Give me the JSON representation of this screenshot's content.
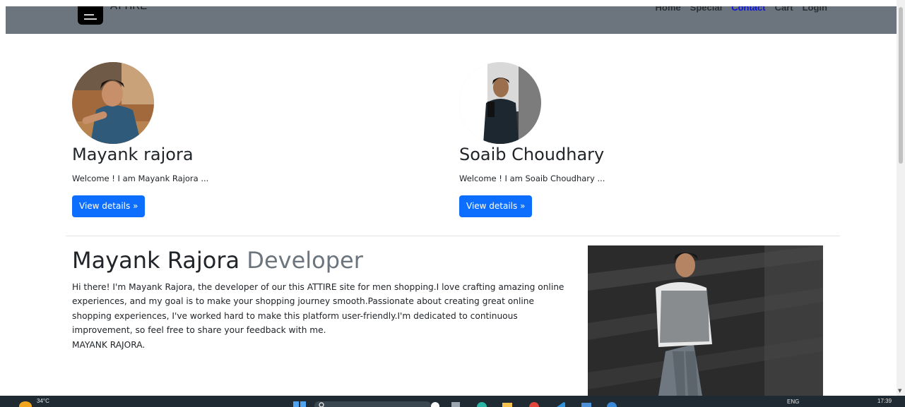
{
  "navbar": {
    "brand": "ATTIRE",
    "links": [
      {
        "label": "Home"
      },
      {
        "label": "Special"
      },
      {
        "label": "Contact"
      },
      {
        "label": "Cart"
      },
      {
        "label": "Login"
      }
    ],
    "active_link": "Contact"
  },
  "team": [
    {
      "name": "Mayank rajora",
      "description": "Welcome ! I am Mayank Rajora ...",
      "button": "View details »"
    },
    {
      "name": "Soaib Choudhary",
      "description": "Welcome ! I am Soaib Choudhary ...",
      "button": "View details »"
    }
  ],
  "featurette": {
    "heading": "Mayank Rajora",
    "heading_muted": "Developer",
    "bio": "Hi there! I'm Mayank Rajora, the developer of our this ATTIRE site for men shopping.I love crafting amazing online experiences, and my goal is to make your shopping journey smooth.Passionate about creating great online shopping experiences, I've worked hard to make this platform user-friendly.I'm dedicated to continuous improvement, so feel free to share your feedback with me.",
    "signoff": "MAYANK RAJORA."
  },
  "taskbar": {
    "temperature": "34°C",
    "language": "ENG",
    "time": "17:39"
  },
  "colors": {
    "navbar_bg": "#6c757d",
    "primary_button": "#0d6efd",
    "active_link": "#0d14d8",
    "muted_text": "#6c757d"
  },
  "icons": [
    "menu-icon",
    "weather-icon",
    "windows-start-icon",
    "search-icon",
    "browser-icon",
    "folder-icon",
    "vscode-icon"
  ]
}
